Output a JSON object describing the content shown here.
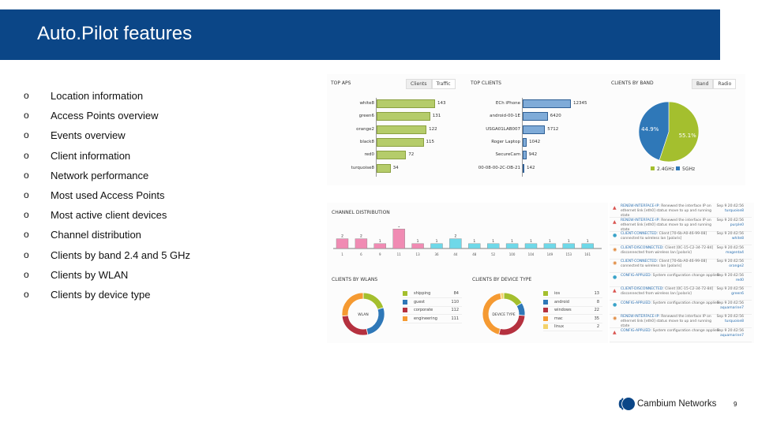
{
  "slide": {
    "title": "Auto.Pilot features",
    "page": "9",
    "logo_text": "Cambium Networks",
    "bullets": [
      "Location information",
      "Access Points overview",
      "Events overview",
      "Client information",
      "Network performance",
      "Most used Access Points",
      "Most active client devices",
      "Channel distribution",
      "Clients by band 2.4 and 5 GHz",
      "Clients by WLAN",
      "Clients by device type"
    ],
    "bullet_marker": "o"
  },
  "dashboard": {
    "top_aps": {
      "title": "TOP APS",
      "buttons": [
        "Clients",
        "Traffic"
      ],
      "labels": [
        "white8",
        "green6",
        "orange2",
        "black8",
        "red0",
        "turquoise8"
      ],
      "values": [
        143,
        131,
        122,
        115,
        72,
        34
      ],
      "color": "#b5cc6a"
    },
    "top_clients": {
      "title": "TOP CLIENTS",
      "labels": [
        "ECh iPhone",
        "android-00-1E",
        "USGA01LAB007",
        "Roger Laptop",
        "SecureCam",
        "00-08-00-2C-DB-21"
      ],
      "values": [
        12345,
        6420,
        5712,
        1042,
        942,
        142
      ],
      "color": "#7fabd8"
    },
    "clients_by_band": {
      "title": "CLIENTS BY BAND",
      "buttons": [
        "Band",
        "Radio"
      ],
      "slices": [
        {
          "name": "2.4GHz",
          "value": 55.1,
          "label": "55.1%",
          "color": "#a4bf2e"
        },
        {
          "name": "5GHz",
          "value": 44.9,
          "label": "44.9%",
          "color": "#2f78b8"
        }
      ]
    },
    "channel_distribution": {
      "title": "CHANNEL DISTRIBUTION",
      "channels": [
        "1",
        "6",
        "9",
        "11",
        "13",
        "36",
        "44",
        "48",
        "52",
        "100",
        "104",
        "149",
        "153",
        "161"
      ],
      "values": [
        2,
        2,
        1,
        4,
        1,
        1,
        2,
        1,
        1,
        1,
        1,
        1,
        1,
        1
      ],
      "band_colors": {
        "2.4": "#f08bb3",
        "5": "#6fd8e8"
      }
    },
    "clients_by_wlans": {
      "title": "CLIENTS BY WLANS",
      "center": "WLAN",
      "items": [
        {
          "name": "shipping",
          "value": 84,
          "color": "#a4bf2e"
        },
        {
          "name": "guest",
          "value": 110,
          "color": "#2f78b8"
        },
        {
          "name": "corporate",
          "value": 112,
          "color": "#b5313f"
        },
        {
          "name": "engineering",
          "value": 111,
          "color": "#f59a32"
        }
      ]
    },
    "clients_by_device": {
      "title": "CLIENTS BY DEVICE TYPE",
      "center": "DEVICE TYPE",
      "items": [
        {
          "name": "ios",
          "value": 13,
          "color": "#a4bf2e"
        },
        {
          "name": "android",
          "value": 8,
          "color": "#2f78b8"
        },
        {
          "name": "windows",
          "value": 22,
          "color": "#b5313f"
        },
        {
          "name": "mac",
          "value": 35,
          "color": "#f59a32"
        },
        {
          "name": "linux",
          "value": 2,
          "color": "#f3d26a"
        }
      ]
    },
    "events": [
      {
        "type": "warn",
        "code": "RENEW-INTERFACE-IP:",
        "text": "Renewed the interface IP on ethernet link [eth0] status move to up and running state",
        "time": "Sep 9 20:42:56",
        "ap": "turquoise8"
      },
      {
        "type": "warn",
        "code": "RENEW-INTERFACE-IP:",
        "text": "Renewed the interface IP on ethernet link [eth0] status move to up and running state",
        "time": "Sep 9 20:42:56",
        "ap": "purple0"
      },
      {
        "type": "info",
        "code": "CLIENT-CONNECTED:",
        "text": "Client [70-6b-A0-46-99-08] connected to wireless lan [polaris]",
        "time": "Sep 9 20:42:56",
        "ap": "white8"
      },
      {
        "type": "error",
        "code": "CLIENT-DISCONNECTED:",
        "text": "Client [0C-15-C2-34-72-84] disconnected from wireless lan [polaris]",
        "time": "Sep 9 20:42:56",
        "ap": "magenta4"
      },
      {
        "type": "error",
        "code": "CLIENT-CONNECTED:",
        "text": "Client [70-6b-A0-46-99-08] connected to wireless lan [polaris]",
        "time": "Sep 9 20:42:56",
        "ap": "orange2"
      },
      {
        "type": "info",
        "code": "CONFIG-APPLIED:",
        "text": "System configuration change applied",
        "time": "Sep 9 20:42:56",
        "ap": "red0"
      },
      {
        "type": "warn",
        "code": "CLIENT-DISCONNECTED:",
        "text": "Client [0C-15-C2-34-72-84] disconnected from wireless lan [polaris]",
        "time": "Sep 9 20:42:56",
        "ap": "green6"
      },
      {
        "type": "info",
        "code": "CONFIG-APPLIED:",
        "text": "System configuration change applied",
        "time": "Sep 9 20:42:56",
        "ap": "aquamarine7"
      },
      {
        "type": "error",
        "code": "RENEW-INTERFACE-IP:",
        "text": "Renewed the interface IP on ethernet link [eth0] status move to up and running state",
        "time": "Sep 9 20:42:56",
        "ap": "turquoise8"
      },
      {
        "type": "warn",
        "code": "CONFIG-APPLIED:",
        "text": "System configuration change applied",
        "time": "Sep 9 20:42:56",
        "ap": "aquamarine7"
      }
    ]
  }
}
